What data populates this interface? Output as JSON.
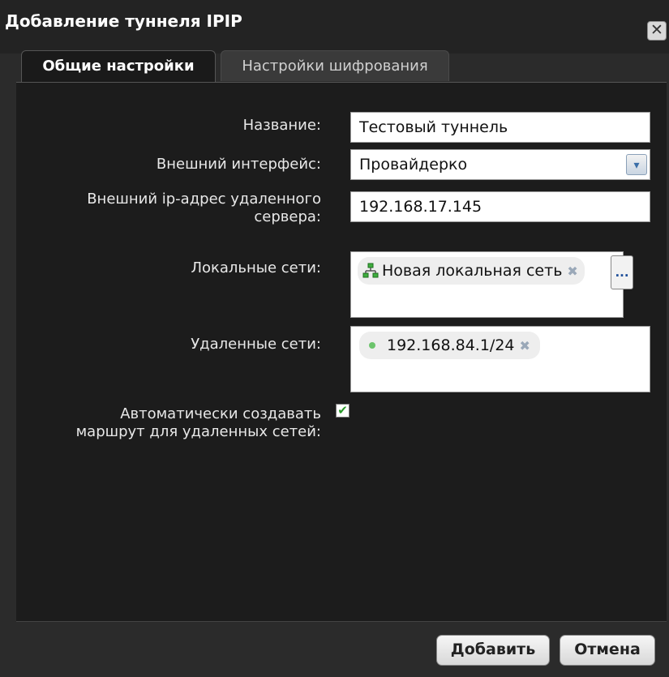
{
  "dialog": {
    "title": "Добавление туннеля IPIP",
    "close_glyph": "✕"
  },
  "tabs": [
    {
      "label": "Общие настройки",
      "active": true
    },
    {
      "label": "Настройки шифрования",
      "active": false
    }
  ],
  "form": {
    "name_label": "Название:",
    "name_value": "Тестовый туннель",
    "iface_label": "Внешний интерфейс:",
    "iface_value": "Провайдерко",
    "remote_ip_label_1": "Внешний ip-адрес удаленного",
    "remote_ip_label_2": "сервера:",
    "remote_ip_value": "192.168.17.145",
    "local_nets_label": "Локальные сети:",
    "local_nets_tag": "Новая локальная сеть",
    "local_nets_tag_remove": "✖",
    "browse_glyph": "...",
    "remote_nets_label": "Удаленные сети:",
    "remote_nets_tag": "192.168.84.1/24",
    "remote_nets_tag_remove": "✖",
    "auto_route_label_1": "Автоматически создавать",
    "auto_route_label_2": "маршрут для удаленных сетей:",
    "auto_route_checked": true,
    "check_glyph": "✔"
  },
  "footer": {
    "add_label": "Добавить",
    "cancel_label": "Отмена"
  },
  "icons": {
    "network": "network-icon",
    "subnet": "subnet-dot-icon",
    "dropdown": "chevron-down-icon"
  },
  "colors": {
    "panel_bg": "#1c1c1c",
    "titlebar_bg": "#232323",
    "subnet_dot": "#6cc46c",
    "check": "#2a9a2a"
  }
}
